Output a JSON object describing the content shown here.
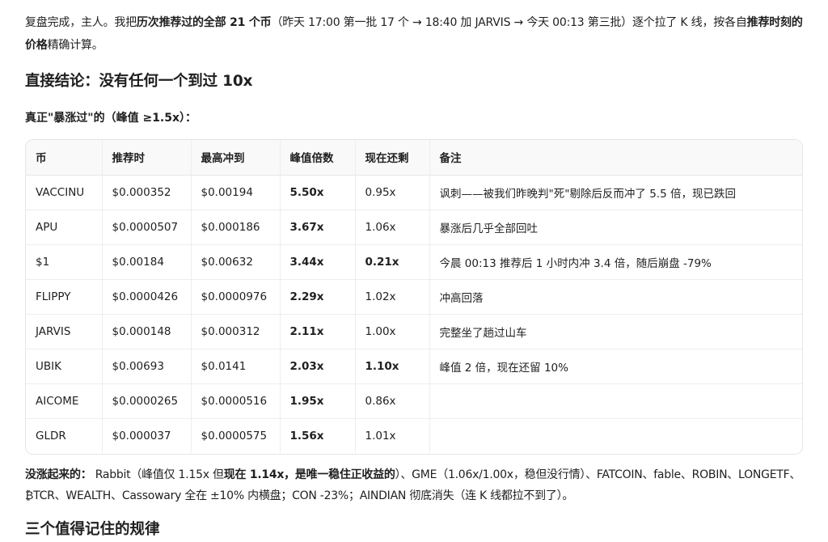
{
  "intro": {
    "p1": "复盘完成，主人。我把",
    "b1": "历次推荐过的全部 21 个币",
    "p2": "（昨天 17:00 第一批 17 个 → 18:40 加 JARVIS → 今天 00:13 第三批）逐个拉了 K 线，按各自",
    "b2": "推荐时刻的价格",
    "p3": "精确计算。"
  },
  "conclusion_heading": "直接结论：没有任何一个到过 10x",
  "surge_heading": "真正\"暴涨过\"的（峰值 ≥1.5x）：",
  "table": {
    "columns": [
      "币",
      "推荐时",
      "最高冲到",
      "峰值倍数",
      "现在还剩",
      "备注"
    ],
    "rows": [
      {
        "coin": "VACCINU",
        "rec": "$0.000352",
        "high": "$0.00194",
        "peak": "5.50x",
        "now": "0.95x",
        "now_bold": false,
        "note": "讽刺——被我们昨晚判\"死\"剔除后反而冲了 5.5 倍，现已跌回"
      },
      {
        "coin": "APU",
        "rec": "$0.0000507",
        "high": "$0.000186",
        "peak": "3.67x",
        "now": "1.06x",
        "now_bold": false,
        "note": "暴涨后几乎全部回吐"
      },
      {
        "coin": "$1",
        "rec": "$0.00184",
        "high": "$0.00632",
        "peak": "3.44x",
        "now": "0.21x",
        "now_bold": true,
        "note": "今晨 00:13 推荐后 1 小时内冲 3.4 倍，随后崩盘 -79%"
      },
      {
        "coin": "FLIPPY",
        "rec": "$0.0000426",
        "high": "$0.0000976",
        "peak": "2.29x",
        "now": "1.02x",
        "now_bold": false,
        "note": "冲高回落"
      },
      {
        "coin": "JARVIS",
        "rec": "$0.000148",
        "high": "$0.000312",
        "peak": "2.11x",
        "now": "1.00x",
        "now_bold": false,
        "note": "完整坐了趟过山车"
      },
      {
        "coin": "UBIK",
        "rec": "$0.00693",
        "high": "$0.0141",
        "peak": "2.03x",
        "now": "1.10x",
        "now_bold": true,
        "note": "峰值 2 倍，现在还留 10%"
      },
      {
        "coin": "AICOME",
        "rec": "$0.0000265",
        "high": "$0.0000516",
        "peak": "1.95x",
        "now": "0.86x",
        "now_bold": false,
        "note": ""
      },
      {
        "coin": "GLDR",
        "rec": "$0.000037",
        "high": "$0.0000575",
        "peak": "1.56x",
        "now": "1.01x",
        "now_bold": false,
        "note": ""
      }
    ]
  },
  "not_up": {
    "label": "没涨起来的：",
    "t1": " Rabbit（峰值仅 1.15x 但",
    "b1": "现在 1.14x，是唯一稳住正收益的",
    "t2": "）、GME（1.06x/1.00x，稳但没行情）、FATCOIN、fable、ROBIN、LONGETF、₿TCR、WEALTH、Cassowary 全在 ±10% 内横盘；CON -23%；AINDIAN 彻底消失（连 K 线都拉不到了）。"
  },
  "next_heading_partial": "三个值得记住的规律"
}
